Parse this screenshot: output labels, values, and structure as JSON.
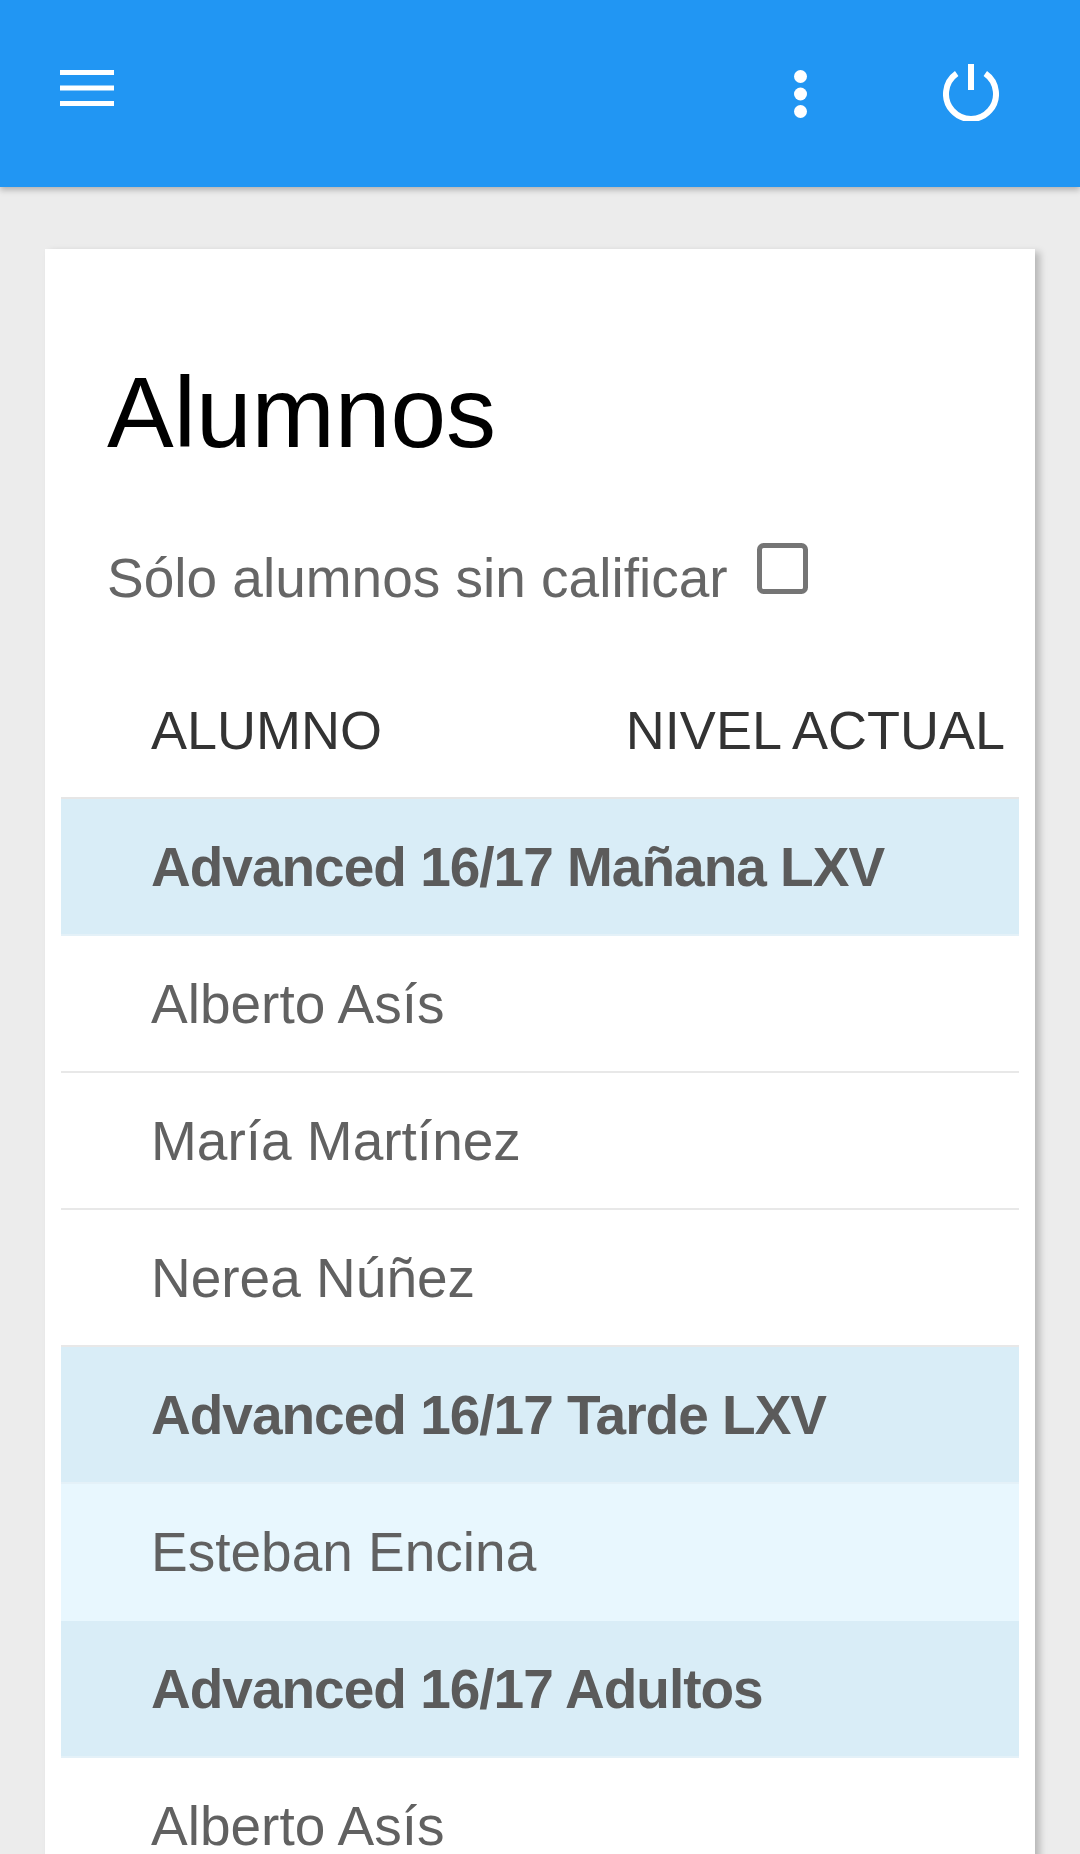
{
  "page": {
    "title": "Alumnos"
  },
  "filter": {
    "label": "Sólo alumnos sin calificar",
    "checked": false
  },
  "table": {
    "columns": [
      "ALUMNO",
      "NIVEL ACTUAL"
    ],
    "rows": [
      {
        "kind": "group",
        "label": "Advanced 16/17 Mañana LXV"
      },
      {
        "kind": "student",
        "name": "Alberto Asís",
        "selected": false
      },
      {
        "kind": "student",
        "name": "María Martínez",
        "selected": false
      },
      {
        "kind": "student",
        "name": "Nerea Núñez",
        "selected": false
      },
      {
        "kind": "group",
        "label": "Advanced 16/17 Tarde LXV"
      },
      {
        "kind": "student",
        "name": "Esteban Encina",
        "selected": true
      },
      {
        "kind": "group",
        "label": "Advanced 16/17 Adultos"
      },
      {
        "kind": "student",
        "name": "Alberto Asís",
        "selected": false
      }
    ]
  }
}
